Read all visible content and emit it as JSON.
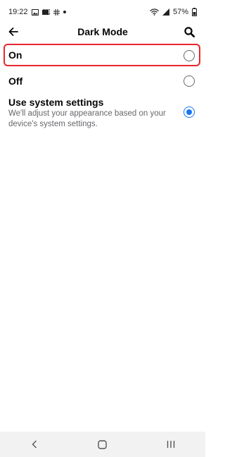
{
  "status_bar": {
    "time": "19:22",
    "battery": "57%",
    "icons": [
      "gallery-icon",
      "media-icon",
      "hashtag-icon",
      "notification-dot"
    ],
    "right_icons": [
      "wifi-icon",
      "signal-icon",
      "battery-icon"
    ]
  },
  "header": {
    "title": "Dark Mode",
    "back_icon": "arrow-left-icon",
    "search_icon": "search-icon"
  },
  "options": [
    {
      "label": "On",
      "selected": false,
      "highlighted": true
    },
    {
      "label": "Off",
      "selected": false
    },
    {
      "label": "Use system settings",
      "description": "We'll adjust your appearance based on your device's system settings.",
      "selected": true
    }
  ],
  "nav_bar": {
    "buttons": [
      "back-nav-icon",
      "home-nav-icon",
      "recents-nav-icon"
    ]
  },
  "colors": {
    "accent": "#1877f2",
    "highlight_border": "#e8262b",
    "secondary_text": "#65676b"
  }
}
